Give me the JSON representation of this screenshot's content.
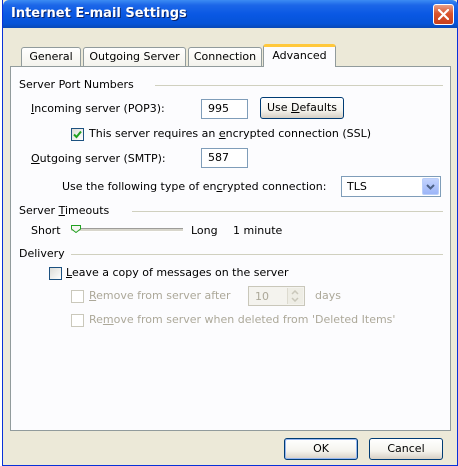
{
  "window": {
    "title": "Internet E-mail Settings"
  },
  "tabs": [
    {
      "label": "General"
    },
    {
      "label": "Outgoing Server"
    },
    {
      "label": "Connection"
    },
    {
      "label": "Advanced",
      "active": true
    }
  ],
  "server_ports": {
    "heading": "Server Port Numbers",
    "incoming": {
      "label_accel": "I",
      "label_rest": "ncoming server (POP3):",
      "value": "995"
    },
    "use_defaults": {
      "label_pre": "Use ",
      "label_accel": "D",
      "label_post": "efaults"
    },
    "ssl_checkbox": {
      "checked": true,
      "label_pre": "This server requires an ",
      "label_accel": "e",
      "label_post": "ncrypted connection (SSL)"
    },
    "outgoing": {
      "label_accel": "O",
      "label_rest": "utgoing server (SMTP):",
      "value": "587"
    },
    "encryption": {
      "label_pre": "Use the following type of en",
      "label_accel": "c",
      "label_post": "rypted connection:",
      "value": "TLS"
    }
  },
  "timeouts": {
    "heading_pre": "Server ",
    "heading_accel": "T",
    "heading_post": "imeouts",
    "short_label": "Short",
    "long_label": "Long",
    "value_text": "1 minute",
    "slider_level": 0
  },
  "delivery": {
    "heading": "Delivery",
    "leave_copy": {
      "checked": false,
      "label_accel": "L",
      "label_rest": "eave a copy of messages on the server"
    },
    "remove_after": {
      "checked": false,
      "enabled": false,
      "label_accel": "R",
      "label_rest": "emove from server after",
      "days_value": "10",
      "days_label": "days"
    },
    "remove_deleted": {
      "checked": false,
      "enabled": false,
      "label_pre": "Re",
      "label_accel": "m",
      "label_post": "ove from server when deleted from 'Deleted Items'"
    }
  },
  "footer": {
    "ok_label": "OK",
    "cancel_label": "Cancel"
  },
  "colors": {
    "titlebar": "#0A58E4",
    "dialog_bg": "#ECE9D8",
    "panel_bg": "#FCFCFE",
    "active_tab_highlight": "#FFC83C",
    "check_mark": "#21A121"
  }
}
